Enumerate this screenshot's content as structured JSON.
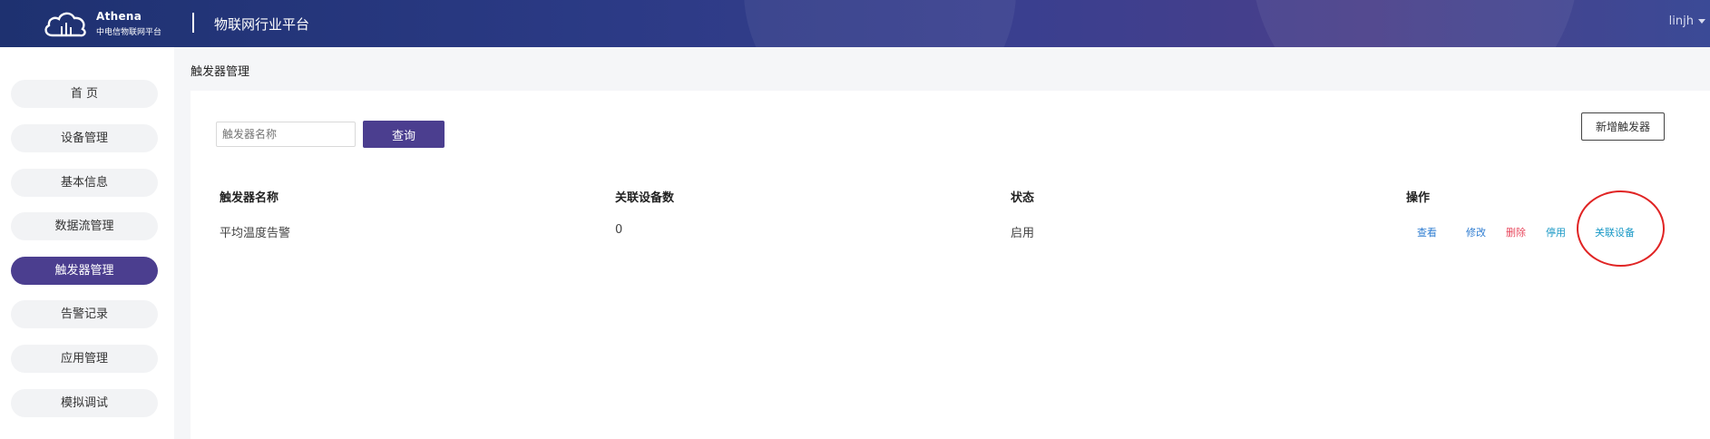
{
  "header": {
    "brand_en": "Athena",
    "brand_cn": "中电信物联网平台",
    "platform_title": "物联网行业平台",
    "user": "linjh"
  },
  "sidebar": {
    "items": [
      {
        "label": "首 页"
      },
      {
        "label": "设备管理"
      },
      {
        "label": "基本信息"
      },
      {
        "label": "数据流管理"
      },
      {
        "label": "触发器管理",
        "active": true
      },
      {
        "label": "告警记录"
      },
      {
        "label": "应用管理"
      },
      {
        "label": "模拟调试"
      }
    ]
  },
  "breadcrumb": "触发器管理",
  "search": {
    "placeholder": "触发器名称",
    "button": "查询"
  },
  "add_button": "新增触发器",
  "table": {
    "headers": [
      "触发器名称",
      "关联设备数",
      "状态",
      "操作"
    ],
    "rows": [
      {
        "name": "平均温度告警",
        "device_count": "0",
        "status": "启用",
        "actions": {
          "view": "查看",
          "edit": "修改",
          "delete": "删除",
          "disable": "停用",
          "link": "关联设备"
        }
      }
    ]
  },
  "colors": {
    "primary": "#4b3e8f",
    "link": "#2f7dd1",
    "danger": "#e84a5f",
    "highlight_ring": "#e02424"
  }
}
